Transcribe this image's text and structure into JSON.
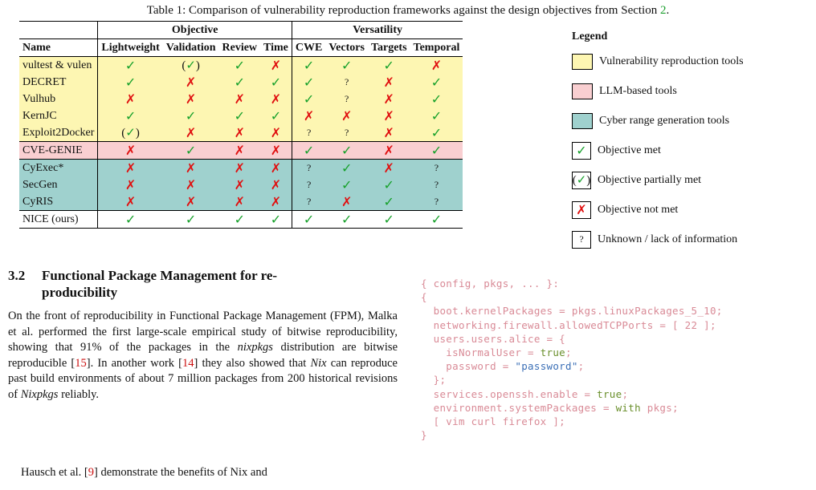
{
  "caption": {
    "text": "Table 1: Comparison of vulnerability reproduction frameworks against the design objectives from Section ",
    "ref": "2",
    "end": "."
  },
  "table": {
    "group_headers": {
      "objective": "Objective",
      "versatility": "Versatility"
    },
    "columns": [
      "Name",
      "Lightweight",
      "Validation",
      "Review",
      "Time",
      "CWE",
      "Vectors",
      "Targets",
      "Temporal"
    ],
    "rows": [
      {
        "name": "vultest & vulen",
        "group": "yellow",
        "cells": [
          "check",
          "partial",
          "check",
          "cross",
          "check",
          "check",
          "check",
          "cross"
        ]
      },
      {
        "name": "DECRET",
        "group": "yellow",
        "cells": [
          "check",
          "cross",
          "check",
          "check",
          "check",
          "unknown",
          "cross",
          "check"
        ]
      },
      {
        "name": "Vulhub",
        "group": "yellow",
        "cells": [
          "cross",
          "cross",
          "cross",
          "cross",
          "check",
          "unknown",
          "cross",
          "check"
        ]
      },
      {
        "name": "KernJC",
        "group": "yellow",
        "cells": [
          "check",
          "check",
          "check",
          "check",
          "cross",
          "cross",
          "cross",
          "check"
        ]
      },
      {
        "name": "Exploit2Docker",
        "group": "yellow",
        "cells": [
          "partial",
          "cross",
          "cross",
          "cross",
          "unknown",
          "unknown",
          "cross",
          "check"
        ]
      },
      {
        "name": "CVE-GENIE",
        "group": "pink",
        "cells": [
          "cross",
          "check",
          "cross",
          "cross",
          "check",
          "check",
          "cross",
          "check"
        ]
      },
      {
        "name": "CyExec*",
        "group": "teal",
        "cells": [
          "cross",
          "cross",
          "cross",
          "cross",
          "unknown",
          "check",
          "cross",
          "unknown"
        ]
      },
      {
        "name": "SecGen",
        "group": "teal",
        "cells": [
          "cross",
          "cross",
          "cross",
          "cross",
          "unknown",
          "check",
          "check",
          "unknown"
        ]
      },
      {
        "name": "CyRIS",
        "group": "teal",
        "cells": [
          "cross",
          "cross",
          "cross",
          "cross",
          "unknown",
          "cross",
          "check",
          "unknown"
        ]
      },
      {
        "name": "NICE (ours)",
        "group": "nice",
        "cells": [
          "check",
          "check",
          "check",
          "check",
          "check",
          "check",
          "check",
          "check"
        ]
      }
    ]
  },
  "symbols": {
    "check": "✓",
    "cross": "✗",
    "unknown": "?",
    "paren_open": "(",
    "paren_close": ")"
  },
  "legend": {
    "title": "Legend",
    "items": [
      {
        "kind": "color",
        "color": "#fdf6b2",
        "label": "Vulnerability reproduction tools"
      },
      {
        "kind": "color",
        "color": "#f9cfd1",
        "label": "LLM-based tools"
      },
      {
        "kind": "color",
        "color": "#9fd1ce",
        "label": "Cyber range generation tools"
      },
      {
        "kind": "symbol",
        "symbol": "check",
        "label": "Objective met"
      },
      {
        "kind": "symbol",
        "symbol": "partial",
        "label": "Objective partially met"
      },
      {
        "kind": "symbol",
        "symbol": "cross",
        "label": "Objective not met"
      },
      {
        "kind": "symbol",
        "symbol": "unknown",
        "label": "Unknown / lack of information"
      }
    ]
  },
  "section": {
    "number": "3.2",
    "title_line1": "Functional Package Management for re-",
    "title_line2": "producibility"
  },
  "paragraph1": {
    "p1": "On the front of reproducibility in Functional Package Management (FPM), Malka et al. performed the first large-scale empirical study of bitwise reproducibility, showing that 91% of the packages in the ",
    "i1": "nixpkgs",
    "p2": " distribution are bitwise reproducible [",
    "r1": "15",
    "p3": "]. In another work [",
    "r2": "14",
    "p4": "] they also showed that ",
    "i2": "Nix",
    "p5": " can reproduce past build environments of about 7 million packages from 200 historical revisions of ",
    "i3": "Nixpkgs",
    "p6": " reliably."
  },
  "paragraph2": {
    "p1": "Hausch et al. [",
    "r1": "9",
    "p2": "] demonstrate the benefits of Nix and"
  },
  "code": {
    "lines": [
      "{ config, pkgs, ... }:",
      "{",
      "  boot.kernelPackages = pkgs.linuxPackages_5_10;",
      "  networking.firewall.allowedTCPPorts = [ 22 ];",
      "  users.users.alice = {",
      "    isNormalUser = true;",
      "    password = \"password\";",
      "  };",
      "  services.openssh.enable = true;",
      "  environment.systemPackages = with pkgs;",
      "  [ vim curl firefox ];",
      "}"
    ]
  }
}
